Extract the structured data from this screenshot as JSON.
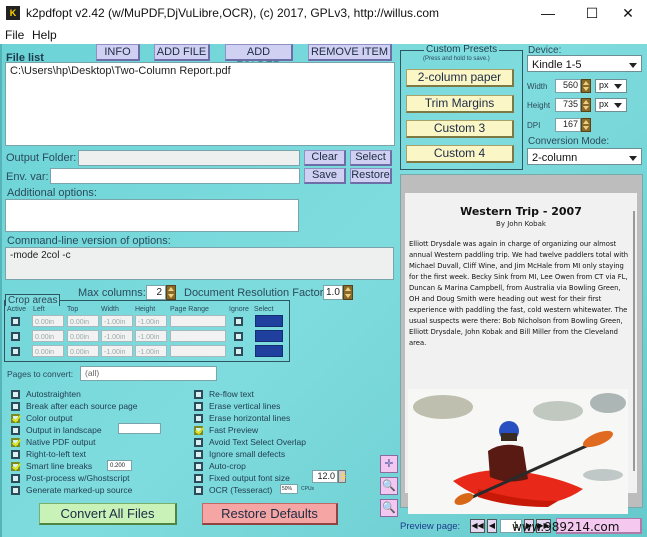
{
  "window": {
    "title": "k2pdfopt v2.42 (w/MuPDF,DjVuLibre,OCR), (c) 2017, GPLv3, http://willus.com",
    "icon_label": "K",
    "controls": {
      "minimize": "—",
      "maximize": "☐",
      "close": "✕"
    }
  },
  "menu": {
    "items": [
      "File",
      "Help"
    ]
  },
  "file_list": {
    "label": "File list",
    "buttons": {
      "info": "INFO",
      "add_file": "ADD FILE",
      "add_folder": "ADD FOLDER",
      "remove_item": "REMOVE ITEM"
    },
    "items": [
      "C:\\Users\\hp\\Desktop\\Two-Column Report.pdf"
    ]
  },
  "output_folder": {
    "label": "Output Folder:",
    "value": "",
    "clear": "Clear",
    "select": "Select"
  },
  "env_var": {
    "label": "Env. var:",
    "value": "",
    "save": "Save",
    "restore": "Restore"
  },
  "additional_options": {
    "label": "Additional options:",
    "value": ""
  },
  "command_line": {
    "label": "Command-line version of options:",
    "value": "-mode 2col -c"
  },
  "max_columns": {
    "label": "Max columns:",
    "value": "2"
  },
  "doc_res_factor": {
    "label": "Document Resolution Factor:",
    "value": "1.0"
  },
  "crop_areas": {
    "label": "Crop areas",
    "headers": [
      "Active",
      "Left",
      "Top",
      "Width",
      "Height",
      "Page Range",
      "Ignore",
      "Select"
    ],
    "rows": [
      {
        "active": false,
        "left": "0.00in",
        "top": "0.00in",
        "width": "-1.00in",
        "height": "-1.00in",
        "page_range": "",
        "ignore": false
      },
      {
        "active": false,
        "left": "0.00in",
        "top": "0.00in",
        "width": "-1.00in",
        "height": "-1.00in",
        "page_range": "",
        "ignore": false
      },
      {
        "active": false,
        "left": "0.00in",
        "top": "0.00in",
        "width": "-1.00in",
        "height": "-1.00in",
        "page_range": "",
        "ignore": false
      }
    ]
  },
  "pages_to_convert": {
    "label": "Pages to convert:",
    "value": "(all)"
  },
  "options_left": [
    {
      "label": "Autostraighten",
      "checked": false
    },
    {
      "label": "Break after each source page",
      "checked": false
    },
    {
      "label": "Color output",
      "checked": true
    },
    {
      "label": "Output in landscape",
      "checked": false
    },
    {
      "label": "Native PDF output",
      "checked": true
    },
    {
      "label": "Right-to-left text",
      "checked": false
    },
    {
      "label": "Smart line breaks",
      "checked": true
    },
    {
      "label": "Post-process w/Ghostscript",
      "checked": false
    },
    {
      "label": "Generate marked-up source",
      "checked": false
    }
  ],
  "smart_line_breaks_value": "0.200",
  "landscape_value": "",
  "options_right": [
    {
      "label": "Re-flow text",
      "checked": false
    },
    {
      "label": "Erase vertical lines",
      "checked": false
    },
    {
      "label": "Erase horizontal lines",
      "checked": false
    },
    {
      "label": "Fast Preview",
      "checked": true
    },
    {
      "label": "Avoid Text Select Overlap",
      "checked": false
    },
    {
      "label": "Ignore small defects",
      "checked": false
    },
    {
      "label": "Auto-crop",
      "checked": false
    },
    {
      "label": "Fixed output font size",
      "checked": false
    },
    {
      "label": "OCR (Tesseract)",
      "checked": false
    }
  ],
  "fixed_font_size_value": "12.0",
  "ocr_value": "50%",
  "ocr_unit": "CPUs",
  "actions": {
    "convert": "Convert All Files",
    "restore_defaults": "Restore Defaults"
  },
  "custom_presets": {
    "label": "Custom Presets",
    "hint": "(Press and hold to save.)",
    "buttons": [
      "2-column paper",
      "Trim Margins",
      "Custom 3",
      "Custom 4"
    ]
  },
  "device": {
    "label": "Device:",
    "value": "Kindle 1-5"
  },
  "width": {
    "label": "Width",
    "value": "560",
    "unit": "px"
  },
  "height": {
    "label": "Height",
    "value": "735",
    "unit": "px"
  },
  "dpi": {
    "label": "DPI",
    "value": "167"
  },
  "conversion_mode": {
    "label": "Conversion Mode:",
    "value": "2-column"
  },
  "preview": {
    "title": "Western Trip - 2007",
    "author": "By John Kobak",
    "body": "Elliott Drysdale was again in charge of organizing our almost annual Western paddling trip. We had twelve paddlers total with Michael Duvall, Cliff Wine, and Jim McHale from MI only staying for the first week. Becky Sink from MI, Lee Owen from CT via FL, Duncan & Marina Campbell, from Australia via Bowling Green, OH and Doug Smith were heading out west for their first experience with paddling the fast, cold western whitewater. The usual suspects were there: Bob Nicholson from Bowling Green, Elliott Drysdale, John Kobak and Bill Miller from the Cleveland area.",
    "page_label": "Preview page:",
    "page_value": "1",
    "nav": {
      "first": "◀◀",
      "prev": "◀",
      "next": "▶",
      "last": "▶▶"
    },
    "watermark": "www.989214.com"
  }
}
